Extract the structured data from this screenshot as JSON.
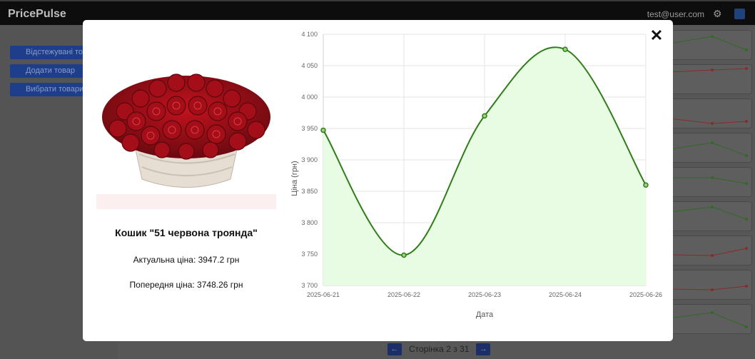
{
  "app": {
    "brand": "PricePulse",
    "user_email": "test@user.com",
    "icons": {
      "settings": "gear-icon",
      "logout": "logout-icon"
    }
  },
  "sidebar": {
    "items": [
      {
        "label": "Відстежувані товари"
      },
      {
        "label": "Додати товар"
      },
      {
        "label": "Вибрати товари"
      }
    ]
  },
  "pagination": {
    "prev_label": "←",
    "next_label": "→",
    "text": "Сторінка 2 з 31"
  },
  "modal": {
    "close_label": "✕",
    "product_title": "Кошик \"51 червона троянда\"",
    "current_price": "Актуальна ціна: 3947.2 грн",
    "previous_price": "Попередня ціна: 3748.26 грн",
    "image_icon": "rose-basket-image"
  },
  "chart_data": {
    "type": "line",
    "x": [
      "2025-06-21",
      "2025-06-22",
      "2025-06-23",
      "2025-06-24",
      "2025-06-26"
    ],
    "values": [
      3947.2,
      3748.26,
      3970,
      4076,
      3860
    ],
    "xlabel": "Дата",
    "ylabel": "Ціна (грн)",
    "ylim": [
      3700,
      4100
    ],
    "yticks": [
      "3 700",
      "3 750",
      "3 800",
      "3 850",
      "3 900",
      "3 950",
      "4 000",
      "4 050",
      "4 100"
    ],
    "grid": true,
    "line_color": "#2e7d18",
    "fill_color": "#e8fbe3"
  }
}
